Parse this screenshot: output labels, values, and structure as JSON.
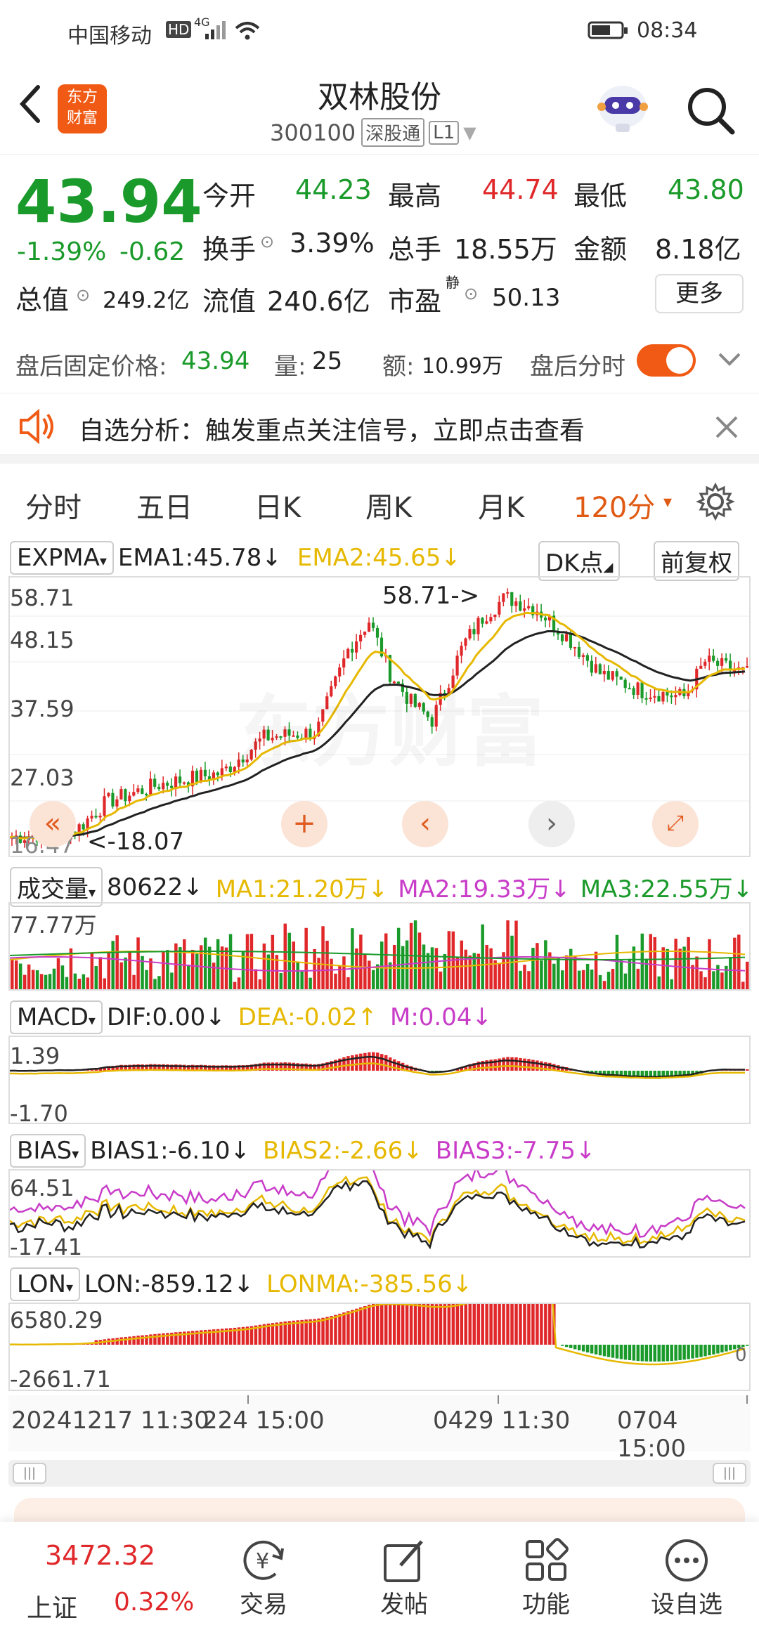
{
  "status_bar": {
    "carrier": "中国移动",
    "hd": "HD",
    "net": "4G",
    "time": "08:34"
  },
  "header": {
    "logo_line1": "东方",
    "logo_line2": "财富",
    "title": "双林股份",
    "code": "300100",
    "exchange_tag": "深股通",
    "level": "L1"
  },
  "quote": {
    "price": "43.94",
    "change_pct": "-1.39%",
    "change": "-0.62",
    "open_label": "今开",
    "open": "44.23",
    "high_label": "最高",
    "high": "44.74",
    "low_label": "最低",
    "low": "43.80",
    "turnover_label": "换手",
    "turnover": "3.39%",
    "volume_label": "总手",
    "volume": "18.55万",
    "amount_label": "金额",
    "amount": "8.18亿",
    "mktcap_label": "总值",
    "mktcap": "249.2亿",
    "float_label": "流值",
    "float": "240.6亿",
    "pe_label": "市盈",
    "pe_sup": "静",
    "pe": "50.13",
    "more_button": "更多"
  },
  "after_hours": {
    "price_label": "盘后固定价格:",
    "price": "43.94",
    "vol_label": "量:",
    "vol": "25",
    "amt_label": "额:",
    "amt": "10.99万",
    "timeshare_label": "盘后分时",
    "toggle_on": true
  },
  "notice": {
    "text": "自选分析：触发重点关注信号，立即点击查看"
  },
  "tabs": {
    "items": [
      "分时",
      "五日",
      "日K",
      "周K",
      "月K"
    ],
    "active": "120分",
    "active_arrow": "▾"
  },
  "kline": {
    "indicator": "EXPMA",
    "ema1": "EMA1:45.78↓",
    "ema2": "EMA2:45.65↓",
    "dk_button": "DK点",
    "adjust_button": "前复权",
    "y_labels": [
      "58.71",
      "48.15",
      "37.59",
      "27.03",
      "16.47"
    ],
    "max_annotation": "58.71->",
    "min_annotation": "<-18.07",
    "watermark": "东方财富"
  },
  "volume": {
    "indicator": "成交量",
    "value": "80622↓",
    "ma1": "MA1:21.20万↓",
    "ma2": "MA2:19.33万↓",
    "ma3": "MA3:22.55万↓",
    "y_label": "77.77万"
  },
  "macd": {
    "indicator": "MACD",
    "dif": "DIF:0.00↓",
    "dea": "DEA:-0.02↑",
    "m": "M:0.04↓",
    "y_top": "1.39",
    "y_bottom": "-1.70"
  },
  "bias": {
    "indicator": "BIAS",
    "bias1": "BIAS1:-6.10↓",
    "bias2": "BIAS2:-2.66↓",
    "bias3": "BIAS3:-7.75↓",
    "y_top": "64.51",
    "y_bottom": "-17.41"
  },
  "lon": {
    "indicator": "LON",
    "lon": "LON:-859.12↓",
    "lonma": "LONMA:-385.56↓",
    "y_top": "6580.29",
    "y_bottom": "-2661.71",
    "right_zero": "0"
  },
  "x_axis": {
    "labels": [
      "20241217 11:30",
      "224 15:00",
      "0429 11:30",
      "0704 15:00"
    ]
  },
  "bottom_bar": {
    "index_value": "3472.32",
    "index_name": "上证",
    "index_change": "0.32%",
    "items": [
      {
        "label": "交易"
      },
      {
        "label": "发帖"
      },
      {
        "label": "功能"
      },
      {
        "label": "设自选"
      }
    ]
  },
  "colors": {
    "up": "#e0282a",
    "down": "#1a9a2a",
    "accent": "#f05a14",
    "ema2": "#e6b800",
    "ema1": "#222222",
    "ma2": "#c83cc8"
  }
}
